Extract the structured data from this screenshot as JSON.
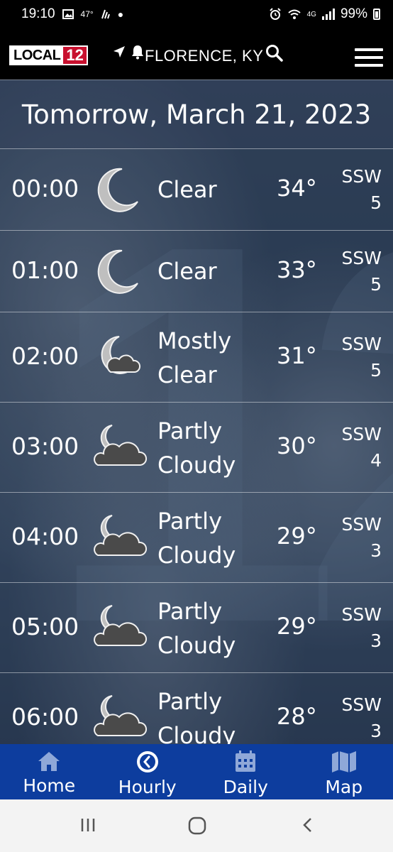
{
  "status_bar": {
    "time": "19:10",
    "temp_indicator": "47°",
    "network": "4G",
    "battery_percent": "99%"
  },
  "header": {
    "logo_text": "LOCAL",
    "logo_number": "12",
    "location": "FLORENCE, KY"
  },
  "forecast": {
    "date_title": "Tomorrow, March 21, 2023",
    "hours": [
      {
        "time": "00:00",
        "icon": "moon-icon",
        "condition_line1": "Clear",
        "condition_line2": "",
        "temp": "34°",
        "wind_dir": "SSW",
        "wind_speed": "5"
      },
      {
        "time": "01:00",
        "icon": "moon-icon",
        "condition_line1": "Clear",
        "condition_line2": "",
        "temp": "33°",
        "wind_dir": "SSW",
        "wind_speed": "5"
      },
      {
        "time": "02:00",
        "icon": "moon-small-cloud-icon",
        "condition_line1": "Mostly",
        "condition_line2": "Clear",
        "temp": "31°",
        "wind_dir": "SSW",
        "wind_speed": "5"
      },
      {
        "time": "03:00",
        "icon": "moon-cloud-icon",
        "condition_line1": "Partly",
        "condition_line2": "Cloudy",
        "temp": "30°",
        "wind_dir": "SSW",
        "wind_speed": "4"
      },
      {
        "time": "04:00",
        "icon": "moon-cloud-icon",
        "condition_line1": "Partly",
        "condition_line2": "Cloudy",
        "temp": "29°",
        "wind_dir": "SSW",
        "wind_speed": "3"
      },
      {
        "time": "05:00",
        "icon": "moon-cloud-icon",
        "condition_line1": "Partly",
        "condition_line2": "Cloudy",
        "temp": "29°",
        "wind_dir": "SSW",
        "wind_speed": "3"
      },
      {
        "time": "06:00",
        "icon": "moon-cloud-icon",
        "condition_line1": "Partly",
        "condition_line2": "Cloudy",
        "temp": "28°",
        "wind_dir": "SSW",
        "wind_speed": "3"
      }
    ]
  },
  "nav": {
    "items": [
      {
        "label": "Home",
        "icon": "home-icon"
      },
      {
        "label": "Hourly",
        "icon": "clock-icon"
      },
      {
        "label": "Daily",
        "icon": "calendar-icon"
      },
      {
        "label": "Map",
        "icon": "map-icon"
      }
    ]
  },
  "colors": {
    "nav_bg": "#0d3d9e",
    "logo_red": "#c8102e"
  }
}
